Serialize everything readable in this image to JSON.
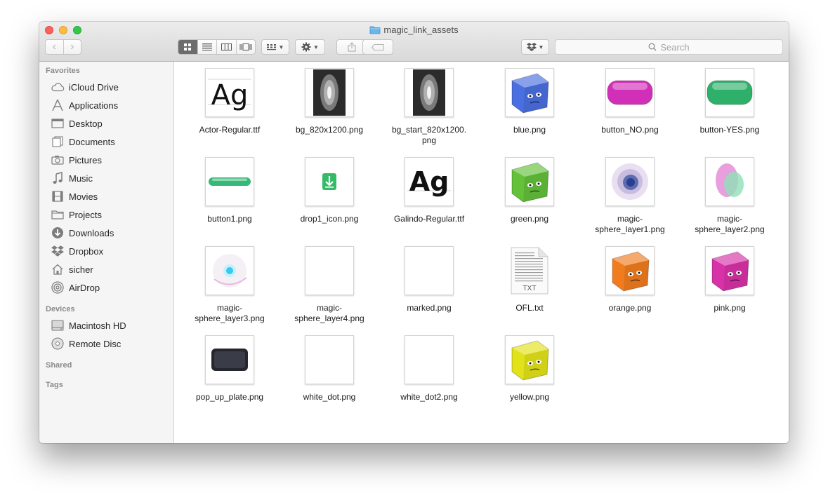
{
  "window": {
    "title": "magic_link_assets"
  },
  "toolbar": {
    "search_placeholder": "Search",
    "back_glyph": "‹",
    "forward_glyph": "›"
  },
  "sidebar": {
    "favorites_label": "Favorites",
    "favorites": [
      {
        "label": "iCloud Drive",
        "icon": "cloud-icon"
      },
      {
        "label": "Applications",
        "icon": "applications-icon"
      },
      {
        "label": "Desktop",
        "icon": "desktop-icon"
      },
      {
        "label": "Documents",
        "icon": "documents-icon"
      },
      {
        "label": "Pictures",
        "icon": "camera-icon"
      },
      {
        "label": "Music",
        "icon": "music-note-icon"
      },
      {
        "label": "Movies",
        "icon": "film-icon"
      },
      {
        "label": "Projects",
        "icon": "folder-icon"
      },
      {
        "label": "Downloads",
        "icon": "download-icon"
      },
      {
        "label": "Dropbox",
        "icon": "dropbox-icon"
      },
      {
        "label": "sicher",
        "icon": "home-icon"
      },
      {
        "label": "AirDrop",
        "icon": "airdrop-icon"
      }
    ],
    "devices_label": "Devices",
    "devices": [
      {
        "label": "Macintosh HD",
        "icon": "hard-drive-icon"
      },
      {
        "label": "Remote Disc",
        "icon": "disc-icon"
      }
    ],
    "shared_label": "Shared",
    "tags_label": "Tags"
  },
  "files": [
    {
      "name": "Actor-Regular.ttf",
      "line1": "Actor-Regular.ttf",
      "line2": "",
      "kind": "font-actor"
    },
    {
      "name": "bg_820x1200.png",
      "line1": "bg_820x1200.png",
      "line2": "",
      "kind": "bg"
    },
    {
      "name": "bg_start_820x1200.png",
      "line1": "bg_start_820x1200.",
      "line2": "png",
      "kind": "bg"
    },
    {
      "name": "blue.png",
      "line1": "blue.png",
      "line2": "",
      "kind": "cube",
      "color": "#4a6fe0"
    },
    {
      "name": "button_NO.png",
      "line1": "button_NO.png",
      "line2": "",
      "kind": "pill",
      "color": "#d22fb8"
    },
    {
      "name": "button-YES.png",
      "line1": "button-YES.png",
      "line2": "",
      "kind": "pill",
      "color": "#2fb06a"
    },
    {
      "name": "button1.png",
      "line1": "button1.png",
      "line2": "",
      "kind": "slim-pill",
      "color": "#36b877"
    },
    {
      "name": "drop1_icon.png",
      "line1": "drop1_icon.png",
      "line2": "",
      "kind": "drop"
    },
    {
      "name": "Galindo-Regular.ttf",
      "line1": "Galindo-Regular.ttf",
      "line2": "",
      "kind": "font-galindo"
    },
    {
      "name": "green.png",
      "line1": "green.png",
      "line2": "",
      "kind": "cube",
      "color": "#63c13a"
    },
    {
      "name": "magic-sphere_layer1.png",
      "line1": "magic-",
      "line2": "sphere_layer1.png",
      "kind": "sphere1"
    },
    {
      "name": "magic-sphere_layer2.png",
      "line1": "magic-",
      "line2": "sphere_layer2.png",
      "kind": "sphere2"
    },
    {
      "name": "magic-sphere_layer3.png",
      "line1": "magic-",
      "line2": "sphere_layer3.png",
      "kind": "sphere3"
    },
    {
      "name": "magic-sphere_layer4.png",
      "line1": "magic-",
      "line2": "sphere_layer4.png",
      "kind": "blank"
    },
    {
      "name": "marked.png",
      "line1": "marked.png",
      "line2": "",
      "kind": "blank"
    },
    {
      "name": "OFL.txt",
      "line1": "OFL.txt",
      "line2": "",
      "kind": "txt",
      "badge": "TXT"
    },
    {
      "name": "orange.png",
      "line1": "orange.png",
      "line2": "",
      "kind": "cube",
      "color": "#f07c1e"
    },
    {
      "name": "pink.png",
      "line1": "pink.png",
      "line2": "",
      "kind": "cube",
      "color": "#d832a8"
    },
    {
      "name": "pop_up_plate.png",
      "line1": "pop_up_plate.png",
      "line2": "",
      "kind": "plate"
    },
    {
      "name": "white_dot.png",
      "line1": "white_dot.png",
      "line2": "",
      "kind": "blank"
    },
    {
      "name": "white_dot2.png",
      "line1": "white_dot2.png",
      "line2": "",
      "kind": "blank"
    },
    {
      "name": "yellow.png",
      "line1": "yellow.png",
      "line2": "",
      "kind": "cube",
      "color": "#e2e21a"
    }
  ]
}
